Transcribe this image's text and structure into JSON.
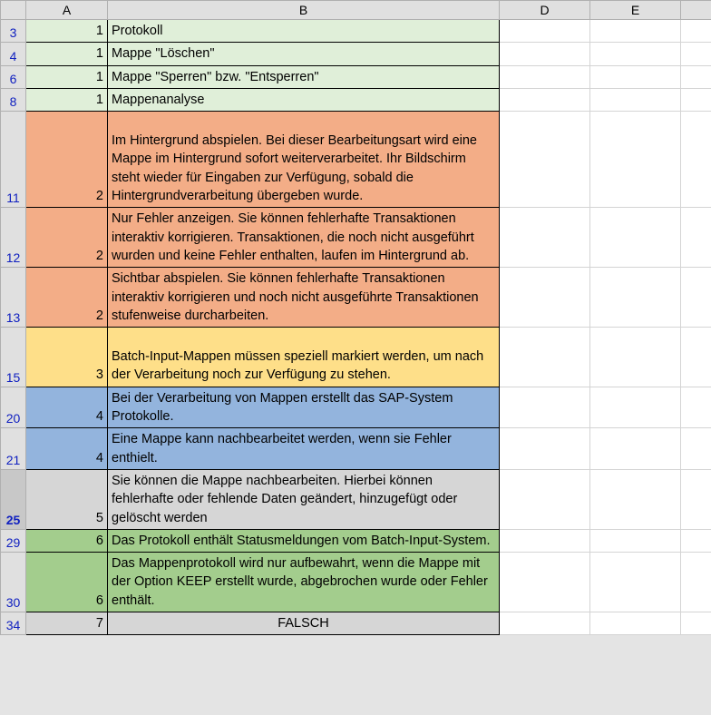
{
  "columns": {
    "A": "A",
    "B": "B",
    "D": "D",
    "E": "E"
  },
  "rows": [
    {
      "num": "3",
      "a": "1",
      "b": "Protokoll",
      "color": "c-green1"
    },
    {
      "num": "4",
      "a": "1",
      "b": "Mappe \"Löschen\"",
      "color": "c-green1"
    },
    {
      "num": "6",
      "a": "1",
      "b": "Mappe \"Sperren\" bzw. \"Entsperren\"",
      "color": "c-green1"
    },
    {
      "num": "8",
      "a": "1",
      "b": "Mappenanalyse",
      "color": "c-green1"
    },
    {
      "num": "11",
      "a": "2",
      "b": "Im Hintergrund abspielen. Bei dieser Bearbeitungsart wird eine Mappe im Hintergrund sofort weiterverarbeitet. Ihr Bildschirm steht wieder für Eingaben zur Verfügung, sobald die Hintergrundverarbeitung übergeben wurde.",
      "color": "c-orange",
      "padtop": true
    },
    {
      "num": "12",
      "a": "2",
      "b": "Nur Fehler anzeigen. Sie können fehlerhafte Transaktionen interaktiv korrigieren. Transaktionen, die noch nicht ausgeführt wurden und keine Fehler enthalten, laufen im Hintergrund ab.",
      "color": "c-orange"
    },
    {
      "num": "13",
      "a": "2",
      "b": "Sichtbar abspielen. Sie können fehlerhafte Transaktionen interaktiv korrigieren und noch nicht ausgeführte Transaktionen stufenweise durcharbeiten.",
      "color": "c-orange"
    },
    {
      "num": "15",
      "a": "3",
      "b": "Batch-Input-Mappen müssen speziell markiert werden, um nach der Verarbeitung noch zur Verfügung zu stehen.",
      "color": "c-yellow",
      "padtop": true
    },
    {
      "num": "20",
      "a": "4",
      "b": "Bei der Verarbeitung von Mappen erstellt das SAP-System Protokolle.",
      "color": "c-blue"
    },
    {
      "num": "21",
      "a": "4",
      "b": "Eine Mappe kann nachbearbeitet werden, wenn sie Fehler enthielt.",
      "color": "c-blue"
    },
    {
      "num": "25",
      "a": "5",
      "b": "Sie können die Mappe nachbearbeiten. Hierbei können fehlerhafte oder fehlende Daten geändert, hinzugefügt oder gelöscht werden",
      "color": "c-gray",
      "selected": true
    },
    {
      "num": "29",
      "a": "6",
      "b": "Das Protokoll enthält Statusmeldungen vom Batch-Input-System.",
      "color": "c-green2"
    },
    {
      "num": "30",
      "a": "6",
      "b": "Das Mappenprotokoll wird nur aufbewahrt, wenn die Mappe mit der Option KEEP erstellt wurde, abgebrochen wurde oder Fehler enthält.",
      "color": "c-green2"
    },
    {
      "num": "34",
      "a": "7",
      "b": "FALSCH",
      "color": "c-gray",
      "center": true
    }
  ]
}
